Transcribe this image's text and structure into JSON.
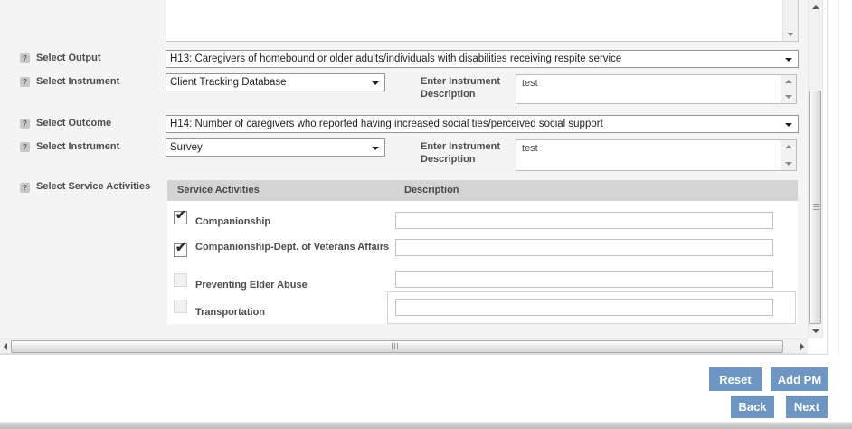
{
  "icons": {
    "help": "?",
    "check": "✔"
  },
  "top_textarea": {
    "value": ""
  },
  "fields": {
    "output": {
      "label": "Select Output",
      "value": "H13: Caregivers of homebound or older adults/individuals with disabilities receiving respite service"
    },
    "instrument1": {
      "label": "Select Instrument",
      "value": "Client Tracking Database",
      "desc_label": "Enter Instrument Description",
      "description": "test"
    },
    "outcome": {
      "label": "Select Outcome",
      "value": "H14: Number of caregivers who reported having increased social ties/perceived social support"
    },
    "instrument2": {
      "label": "Select Instrument",
      "value": "Survey",
      "desc_label": "Enter Instrument Description",
      "description": "test"
    },
    "service_activities": {
      "label": "Select Service Activities"
    }
  },
  "table": {
    "headers": {
      "activities": "Service Activities",
      "description": "Description"
    },
    "rows": [
      {
        "label": "Companionship",
        "checked": true,
        "description": ""
      },
      {
        "label": "Companionship-Dept. of Veterans Affairs",
        "checked": true,
        "description": ""
      },
      {
        "label": "Preventing Elder Abuse",
        "checked": false,
        "description": ""
      },
      {
        "label": "Transportation",
        "checked": false,
        "description": ""
      }
    ]
  },
  "buttons": {
    "reset": "Reset",
    "add_pm": "Add PM",
    "back": "Back",
    "next": "Next"
  }
}
